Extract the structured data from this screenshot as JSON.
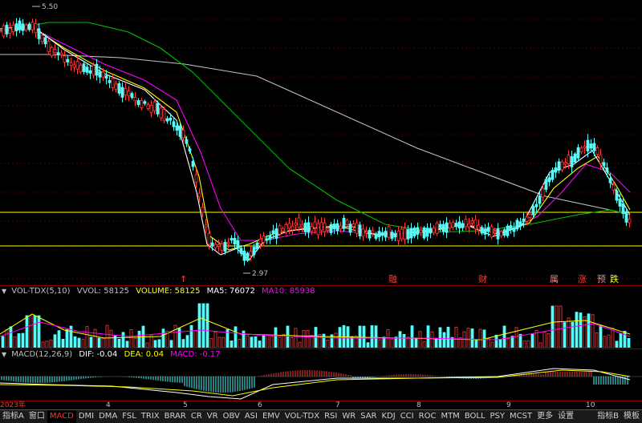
{
  "price_panel": {
    "high_label": "5.50",
    "low_label": "2.97",
    "event_markers": [
      "↑",
      "融",
      "财",
      "属",
      "涨",
      "预",
      "跌"
    ],
    "colors": {
      "up": "#ff3c3c",
      "down": "#54fcfc",
      "ma_short": "#ffffff",
      "ma_mid": "#ffff00",
      "ma_long": "#ff00ff",
      "ma_green": "#00c000",
      "ma_grey": "#c0c0c0",
      "level": "#ffff00"
    }
  },
  "vol_header": {
    "name": "VOL-TDX(5,10)",
    "vvol": "VVOL: 58125",
    "volume": "VOLUME: 58125",
    "ma5": "MA5: 76072",
    "ma10": "MA10: 85938"
  },
  "macd_header": {
    "name": "MACD(12,26,9)",
    "dif": "DIF: -0.04",
    "dea": "DEA: 0.04",
    "macd": "MACD: -0.17"
  },
  "date_axis": [
    "2023年",
    "4",
    "5",
    "6",
    "7",
    "8",
    "9",
    "10"
  ],
  "tabs": [
    "指标A",
    "窗口",
    "MACD",
    "DMI",
    "DMA",
    "FSL",
    "TRIX",
    "BRAR",
    "CR",
    "VR",
    "OBV",
    "ASI",
    "EMV",
    "VOL-TDX",
    "RSI",
    "WR",
    "SAR",
    "KDJ",
    "CCI",
    "ROC",
    "MTM",
    "BOLL",
    "PSY",
    "MCST",
    "更多",
    "设置"
  ],
  "active_tab": "MACD",
  "right_tabs": [
    "指标B",
    "模板"
  ]
}
